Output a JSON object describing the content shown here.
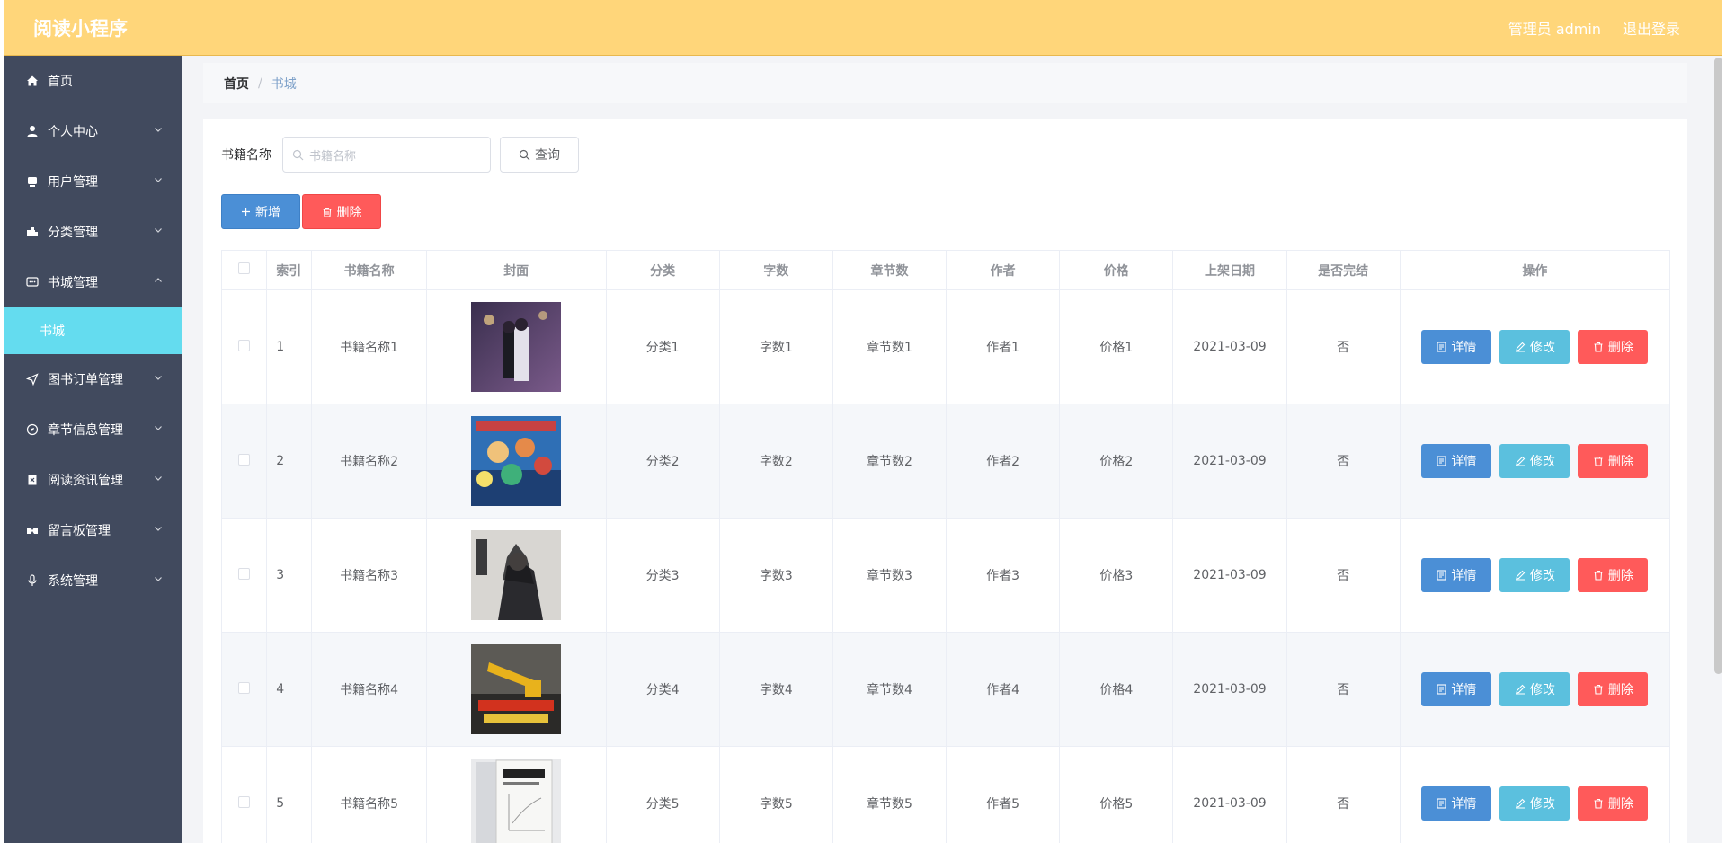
{
  "app": {
    "title": "阅读小程序"
  },
  "header": {
    "user": "管理员 admin",
    "logout": "退出登录"
  },
  "sidebar": {
    "items": [
      {
        "label": "首页",
        "icon": "home-icon"
      },
      {
        "label": "个人中心",
        "icon": "user-icon"
      },
      {
        "label": "用户管理",
        "icon": "users-icon"
      },
      {
        "label": "分类管理",
        "icon": "category-icon"
      },
      {
        "label": "书城管理",
        "icon": "chat-icon",
        "expanded": true
      },
      {
        "label": "图书订单管理",
        "icon": "send-icon"
      },
      {
        "label": "章节信息管理",
        "icon": "compass-icon"
      },
      {
        "label": "阅读资讯管理",
        "icon": "document-icon"
      },
      {
        "label": "留言板管理",
        "icon": "message-icon"
      },
      {
        "label": "系统管理",
        "icon": "microphone-icon"
      }
    ],
    "subitem": "书城"
  },
  "breadcrumb": {
    "home": "首页",
    "sep": "/",
    "current": "书城"
  },
  "search": {
    "label": "书籍名称",
    "placeholder": "书籍名称",
    "button": "查询"
  },
  "actions": {
    "add": "新增",
    "delete": "删除"
  },
  "table": {
    "headers": [
      "索引",
      "书籍名称",
      "封面",
      "分类",
      "字数",
      "章节数",
      "作者",
      "价格",
      "上架日期",
      "是否完结",
      "操作"
    ],
    "rows": [
      {
        "index": "1",
        "name": "书籍名称1",
        "category": "分类1",
        "words": "字数1",
        "chapters": "章节数1",
        "author": "作者1",
        "price": "价格1",
        "date": "2021-03-09",
        "finished": "否"
      },
      {
        "index": "2",
        "name": "书籍名称2",
        "category": "分类2",
        "words": "字数2",
        "chapters": "章节数2",
        "author": "作者2",
        "price": "价格2",
        "date": "2021-03-09",
        "finished": "否"
      },
      {
        "index": "3",
        "name": "书籍名称3",
        "category": "分类3",
        "words": "字数3",
        "chapters": "章节数3",
        "author": "作者3",
        "price": "价格3",
        "date": "2021-03-09",
        "finished": "否"
      },
      {
        "index": "4",
        "name": "书籍名称4",
        "category": "分类4",
        "words": "字数4",
        "chapters": "章节数4",
        "author": "作者4",
        "price": "价格4",
        "date": "2021-03-09",
        "finished": "否"
      },
      {
        "index": "5",
        "name": "书籍名称5",
        "category": "分类5",
        "words": "字数5",
        "chapters": "章节数5",
        "author": "作者5",
        "price": "价格5",
        "date": "2021-03-09",
        "finished": "否"
      }
    ],
    "ops": {
      "detail": "详情",
      "edit": "修改",
      "remove": "删除"
    }
  },
  "colors": {
    "header": "#ffd67a",
    "sidebar": "#414a5e",
    "active": "#64dcef",
    "primary": "#4b8fd6",
    "info": "#5bc0de",
    "danger": "#ff5a5a"
  }
}
